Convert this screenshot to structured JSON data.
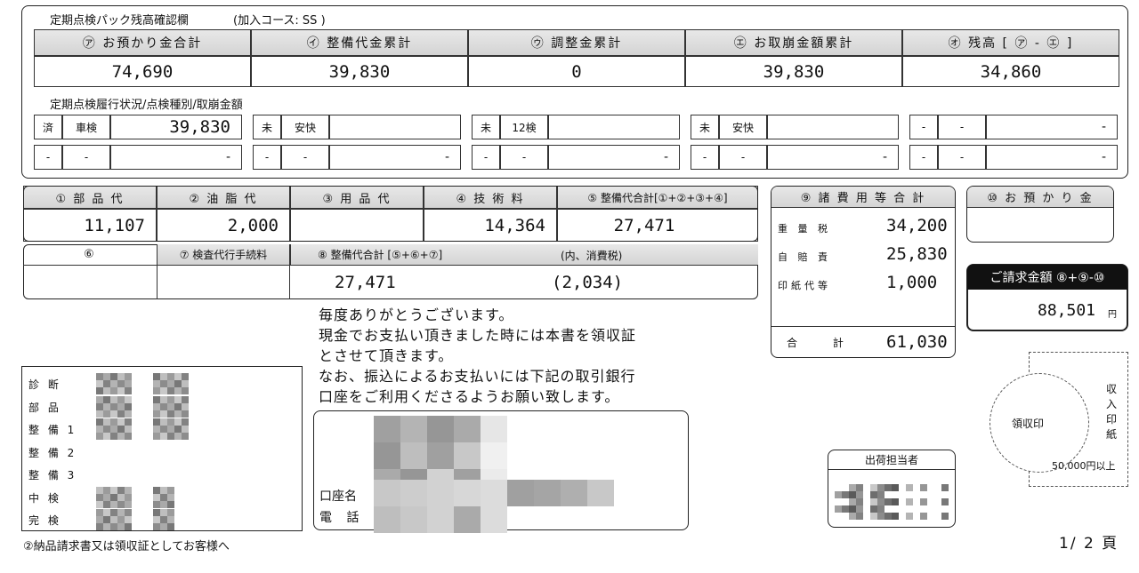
{
  "balance": {
    "title": "定期点検パック残高確認欄",
    "course": "(加入コース: SS )",
    "headers": [
      "㋐ お預かり金合計",
      "㋑ 整備代金累計",
      "㋒ 調整金累計",
      "㋓ お取崩金額累計",
      "㋔ 残高 [ ㋐ - ㋓ ]"
    ],
    "values": [
      "74,690",
      "39,830",
      "0",
      "39,830",
      "34,860"
    ]
  },
  "history": {
    "title": "定期点検履行状況/点検種別/取崩金額",
    "row1": [
      {
        "status": "済",
        "type": "車検",
        "amount": "39,830"
      },
      {
        "status": "未",
        "type": "安快",
        "amount": ""
      },
      {
        "status": "未",
        "type": "12検",
        "amount": ""
      },
      {
        "status": "未",
        "type": "安快",
        "amount": ""
      },
      {
        "status": "-",
        "type": "-",
        "amount": "-"
      }
    ],
    "row2": [
      {
        "status": "-",
        "type": "-",
        "amount": "-"
      },
      {
        "status": "-",
        "type": "-",
        "amount": "-"
      },
      {
        "status": "-",
        "type": "-",
        "amount": "-"
      },
      {
        "status": "-",
        "type": "-",
        "amount": "-"
      },
      {
        "status": "-",
        "type": "-",
        "amount": "-"
      }
    ]
  },
  "charges": {
    "headers1": [
      "① 部 品 代",
      "② 油 脂 代",
      "③ 用 品 代",
      "④ 技 術 料",
      "⑤ 整備代合計[①+②+③+④]"
    ],
    "values1": [
      "11,107",
      "2,000",
      "",
      "14,364",
      "27,471"
    ],
    "h6": "⑥",
    "h7": "⑦ 検査代行手続料",
    "h8": "⑧ 整備代合計 [⑤+⑥+⑦]",
    "h_tax": "(内、消費税)",
    "v8": "27,471",
    "v_tax": "(2,034)"
  },
  "fees": {
    "title": "⑨ 諸 費 用 等 合 計",
    "items": [
      {
        "label": "重 量 税",
        "value": "34,200"
      },
      {
        "label": "自 賠 責",
        "value": "25,830"
      },
      {
        "label": "印紙代等",
        "value": "1,000"
      }
    ],
    "total_label": "合 計",
    "total_value": "61,030"
  },
  "deposit": {
    "title": "⑩ お 預 か り 金"
  },
  "billing": {
    "title": "ご請求金額 ⑧+⑨-⑩",
    "amount": "88,501",
    "unit": "円"
  },
  "message": [
    "毎度ありがとうございます。",
    "現金でお支払い頂きました時には本書を領収証",
    "とさせて頂きます。",
    "なお、振込によるお支払いには下記の取引銀行",
    "口座をご利用くださるようお願い致します。"
  ],
  "bank": {
    "account_label": "口座名",
    "phone_label": "電 話"
  },
  "staff": {
    "labels": [
      "診 断",
      "部 品",
      "整 備 1",
      "整 備 2",
      "整 備 3",
      "中 検",
      "完 検"
    ]
  },
  "shipping": {
    "title": "出荷担当者"
  },
  "seal": {
    "label": "領収印"
  },
  "stamp": {
    "label": "収入印紙",
    "note": "50,000円以上"
  },
  "footer": {
    "copy": "②納品請求書又は領収証としてお客様へ",
    "page": "1/ 2 頁"
  },
  "colors": {
    "ink": "#111111",
    "header_bg": "#d8d8d8",
    "mosaic_dark": "#8a8a8a",
    "mosaic_light": "#cfcfcf"
  }
}
